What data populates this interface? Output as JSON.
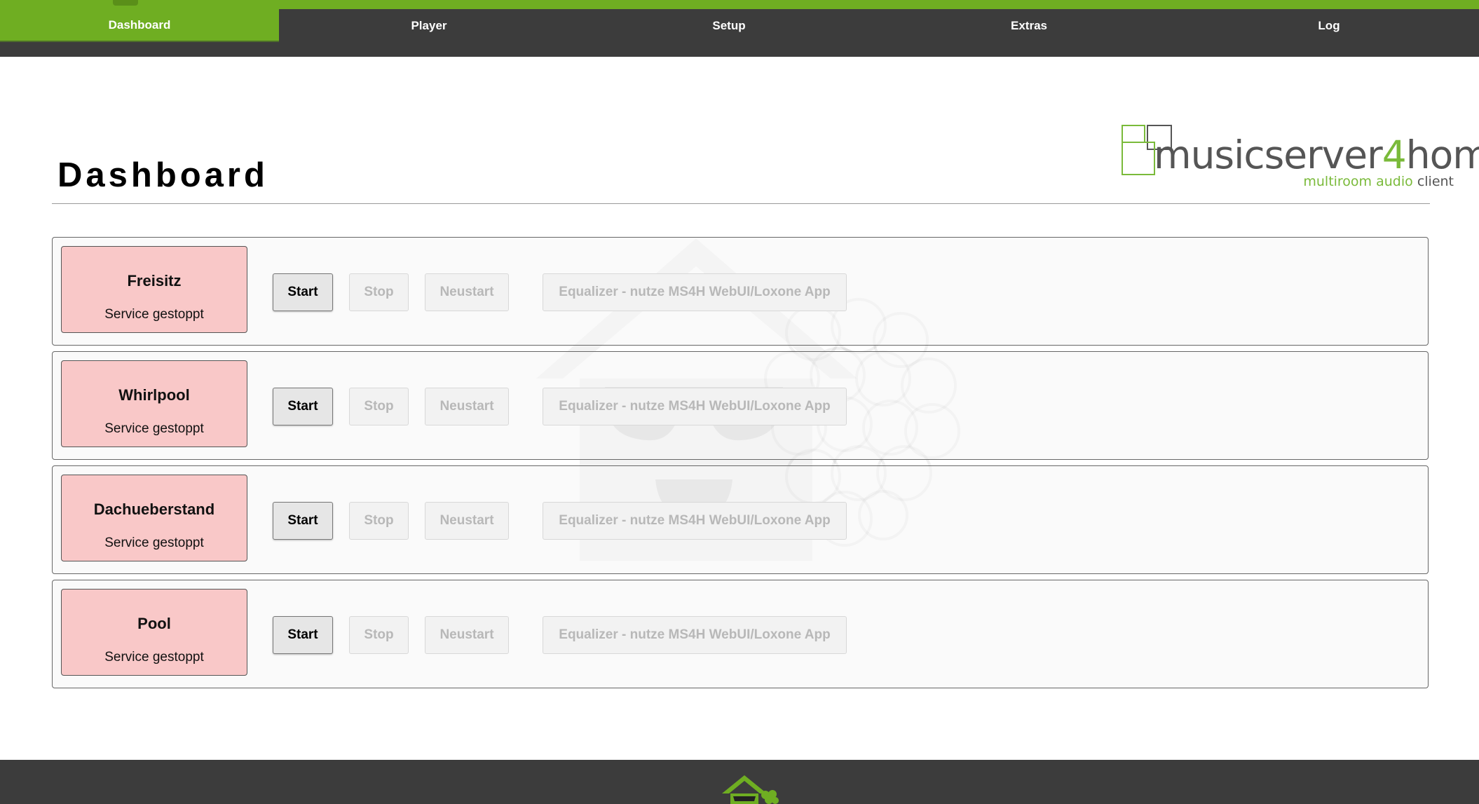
{
  "nav": {
    "items": [
      {
        "label": "Dashboard",
        "active": true
      },
      {
        "label": "Player",
        "active": false
      },
      {
        "label": "Setup",
        "active": false
      },
      {
        "label": "Extras",
        "active": false
      },
      {
        "label": "Log",
        "active": false
      }
    ]
  },
  "page": {
    "title": "Dashboard"
  },
  "logo": {
    "brand_part1": "musicserver",
    "brand_digit": "4",
    "brand_part2": "home",
    "tagline_part1": "multiroom audio",
    "tagline_part2": "client"
  },
  "zones": [
    {
      "name": "Freisitz",
      "status": "Service gestoppt"
    },
    {
      "name": "Whirlpool",
      "status": "Service gestoppt"
    },
    {
      "name": "Dachueberstand",
      "status": "Service gestoppt"
    },
    {
      "name": "Pool",
      "status": "Service gestoppt"
    }
  ],
  "buttons": {
    "start": "Start",
    "stop": "Stop",
    "restart": "Neustart",
    "equalizer": "Equalizer - nutze MS4H WebUI/Loxone App"
  },
  "colors": {
    "accent": "#6fae22",
    "navbar": "#3c3c3c",
    "status_stopped": "#f9c8c8"
  }
}
